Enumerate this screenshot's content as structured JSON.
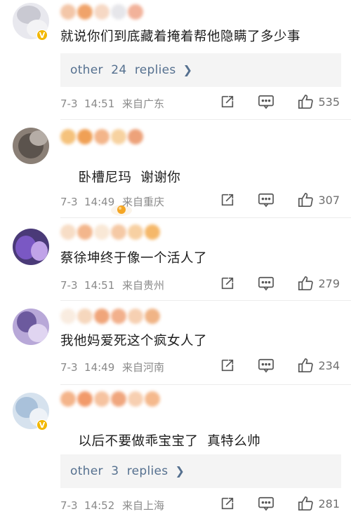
{
  "comments": [
    {
      "text": "就说你们到底藏着掩着帮他隐瞒了多少事",
      "verified": true,
      "replies": "other  24  replies",
      "time": "7-3  14:51",
      "location": "来自广东",
      "likes": "535"
    },
    {
      "text": "卧槽尼玛  谢谢你",
      "verified": false,
      "replies": null,
      "time": "7-3  14:49",
      "location": "来自重庆",
      "likes": "307"
    },
    {
      "text": "蔡徐坤终于像一个活人了",
      "verified": false,
      "replies": null,
      "time": "7-3  14:51",
      "location": "来自贵州",
      "likes": "279"
    },
    {
      "text": "我他妈爱死这个疯女人了",
      "verified": false,
      "replies": null,
      "time": "7-3  14:49",
      "location": "来自河南",
      "likes": "234"
    },
    {
      "text": "以后不要做乖宝宝了  真特么帅",
      "verified": true,
      "replies": "other  3  replies",
      "time": "7-3  14:52",
      "location": "来自上海",
      "likes": "281"
    }
  ],
  "icons": {
    "share": "share-icon",
    "comment": "comment-icon",
    "like": "thumbs-up-icon",
    "chevron": "chevron-right-icon",
    "verified": "verified-badge-icon"
  },
  "colors": {
    "reply_link": "#55708f",
    "reply_bg": "#f4f4f4",
    "verified": "#f2b700",
    "meta": "#8a8a8a"
  }
}
